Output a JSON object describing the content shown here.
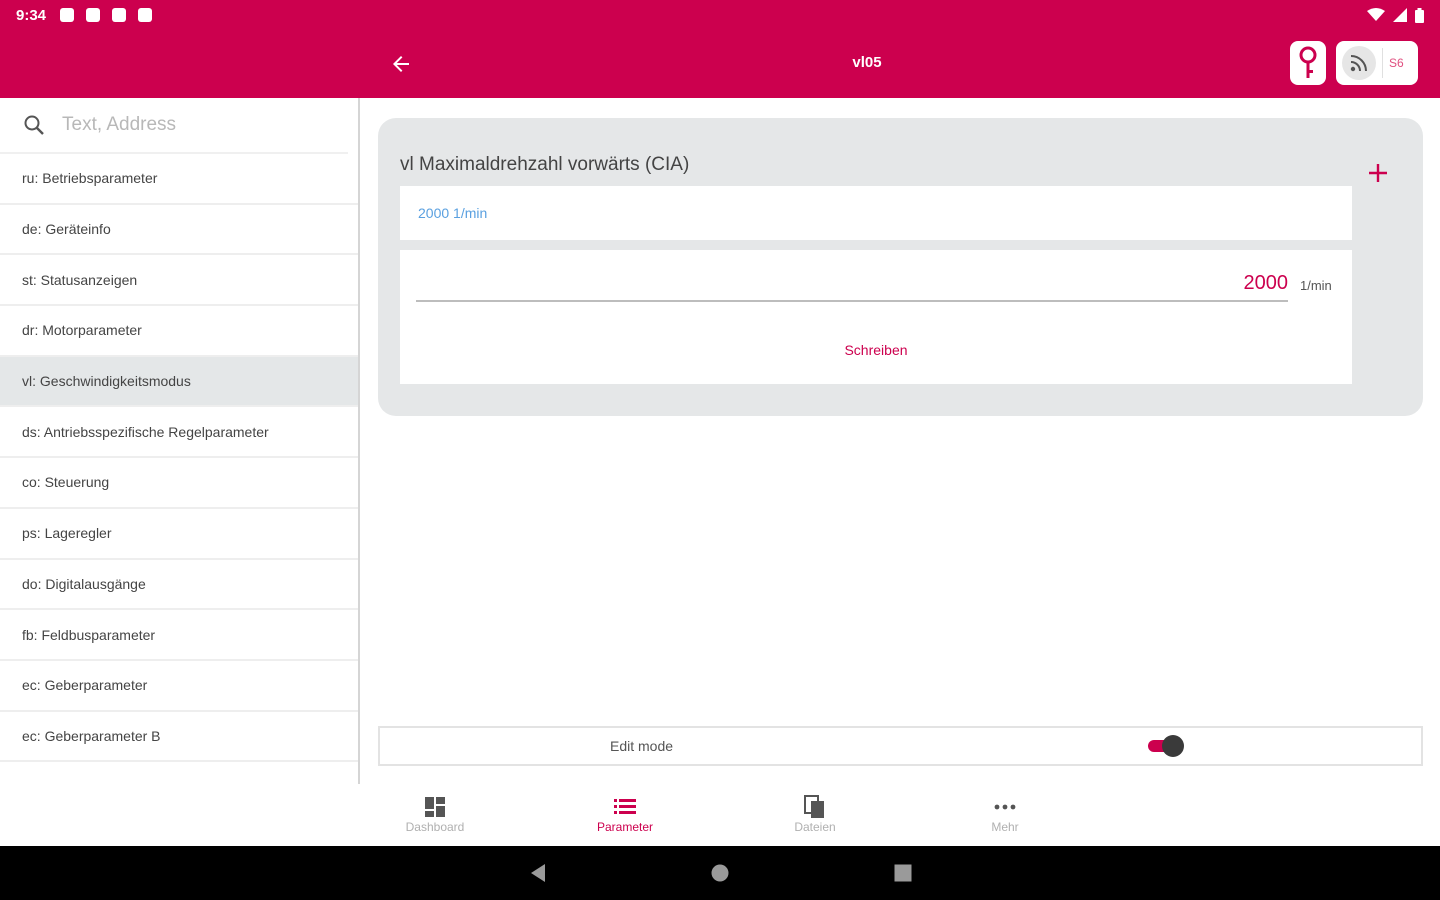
{
  "status_bar": {
    "time": "9:34"
  },
  "app_bar": {
    "title": "vl05",
    "connection_label": "S6"
  },
  "search": {
    "placeholder": "Text, Address"
  },
  "sidebar": {
    "items": [
      {
        "label": "ru: Betriebsparameter"
      },
      {
        "label": "de: Geräteinfo"
      },
      {
        "label": "st: Statusanzeigen"
      },
      {
        "label": "dr: Motorparameter"
      },
      {
        "label": "vl: Geschwindigkeitsmodus"
      },
      {
        "label": "ds: Antriebsspezifische Regelparameter"
      },
      {
        "label": "co: Steuerung"
      },
      {
        "label": "ps: Lageregler"
      },
      {
        "label": "do: Digitalausgänge"
      },
      {
        "label": "fb: Feldbusparameter"
      },
      {
        "label": "ec: Geberparameter"
      },
      {
        "label": "ec: Geberparameter B"
      }
    ]
  },
  "param": {
    "title": "vl Maximaldrehzahl vorwärts (CIA)",
    "current_value": "2000 1/min",
    "write_value": "2000",
    "write_unit": "1/min",
    "write_button": "Schreiben"
  },
  "edit_mode": {
    "label": "Edit mode",
    "enabled": true
  },
  "bottom_nav": {
    "dashboard": "Dashboard",
    "parameter": "Parameter",
    "dateien": "Dateien",
    "mehr": "Mehr"
  },
  "colors": {
    "primary": "#cc004e",
    "card_bg": "#e5e7e8",
    "link_blue": "#5aa0e0"
  }
}
